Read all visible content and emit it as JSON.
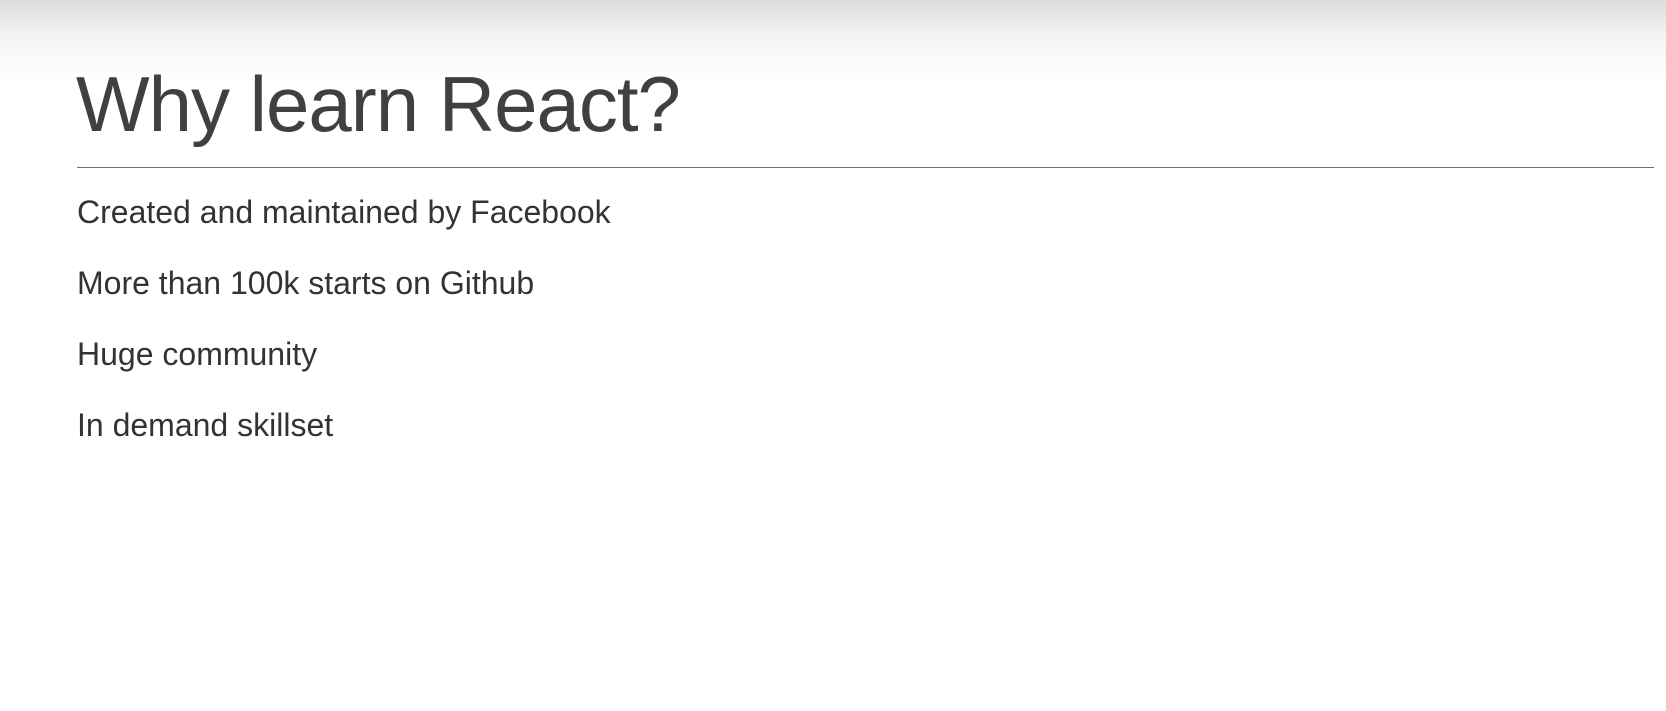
{
  "slide": {
    "title": "Why learn React?",
    "bullets": [
      "Created and maintained by Facebook",
      "More than 100k starts on Github",
      "Huge community",
      "In demand skillset"
    ]
  },
  "colors": {
    "title_text": "#404040",
    "body_text": "#333333",
    "divider": "#6e6e6e",
    "background": "#ffffff"
  }
}
